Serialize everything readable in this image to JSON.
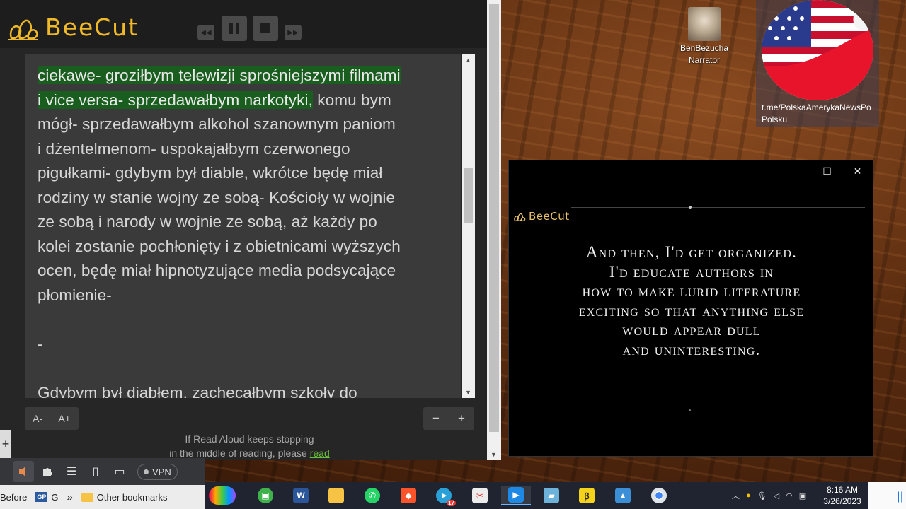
{
  "reader": {
    "brand": "BeeCut",
    "content": {
      "highlight_1": "ciekawe- groziłbym telewizji sprośniejszymi filmami",
      "highlight_2": "i vice versa- sprzedawałbym narkotyki,",
      "line_2_rest": " komu bym",
      "lines": [
        "mógł- sprzedawałbym alkohol szanownym paniom",
        "i dżentelmenom- uspokajałbym czerwonego",
        "pigułkami- gdybym był diable, wkrótce będę miał",
        "rodziny w stanie wojny ze sobą- Kościoły w wojnie",
        "ze sobą i narody w wojnie ze sobą, aż każdy po",
        "kolei zostanie pochłonięty i z obietnicami wyższych",
        "ocen, będę miał hipnotyzujące media podsycające",
        "płomienie-"
      ],
      "separator": "-",
      "next_paragraph": "Gdybym był diabłem, zachęcałbym szkoły do"
    },
    "font_decrease": "A-",
    "font_increase": "A+",
    "zoom_out": "−",
    "zoom_in": "+",
    "notice_line1": "If Read Aloud keeps stopping",
    "notice_line2": "in the middle of reading, please ",
    "notice_link": "read"
  },
  "browser": {
    "new_tab": "+",
    "vpn_label": "VPN",
    "bookmarks": {
      "before": "Before",
      "gp_icon": "GP",
      "g": "G",
      "more": "»",
      "other": "Other bookmarks"
    }
  },
  "desktop": {
    "narrator_name": "BenBezucha",
    "narrator_role": "Narrator",
    "flag_label": "t.me/PolskaAmerykaNewsPo Polsku"
  },
  "video": {
    "brand": "BeeCut",
    "caption_lines": [
      "And then, I'd get organized.",
      "I'd educate authors in",
      "how to make lurid literature",
      "exciting so that anything else",
      "would appear dull",
      "and uninteresting."
    ],
    "minimize": "—",
    "maximize": "☐",
    "close": "✕"
  },
  "taskbar": {
    "time": "8:16 AM",
    "date": "3/26/2023",
    "telegram_badge": "17"
  },
  "colors": {
    "brand_gold": "#f0b928",
    "highlight_green": "#1a5e1f",
    "link_green": "#6abf3a"
  }
}
